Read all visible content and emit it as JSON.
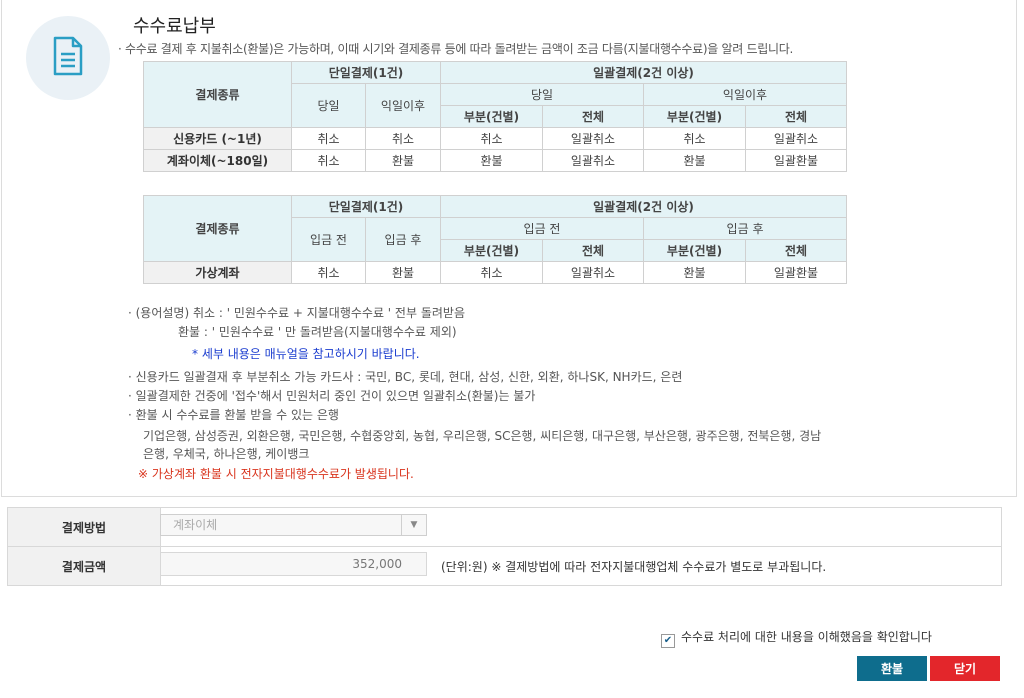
{
  "header": {
    "title": "수수료납부",
    "intro": "· 수수료 결제 후 지불취소(환불)은 가능하며, 이때 시기와 결제종류 등에 따라 돌려받는 금액이 조금 다름(지불대행수수료)을 알려 드립니다."
  },
  "table1": {
    "col_type": "결제종류",
    "single": "단일결제(1건)",
    "bulk": "일괄결제(2건 이상)",
    "sameday": "당일",
    "nextday": "익일이후",
    "partial": "부분(건별)",
    "all": "전체",
    "rows": [
      {
        "label": "신용카드 (~1년)",
        "c1": "취소",
        "c2": "취소",
        "c3": "취소",
        "c4": "일괄취소",
        "c5": "취소",
        "c6": "일괄취소"
      },
      {
        "label": "계좌이체(~180일)",
        "c1": "취소",
        "c2": "환불",
        "c3": "환불",
        "c4": "일괄취소",
        "c5": "환불",
        "c6": "일괄환불"
      }
    ]
  },
  "table2": {
    "col_type": "결제종류",
    "single": "단일결제(1건)",
    "bulk": "일괄결제(2건 이상)",
    "before": "입금 전",
    "after": "입금 후",
    "partial": "부분(건별)",
    "all": "전체",
    "rows": [
      {
        "label": "가상계좌",
        "c1": "취소",
        "c2": "환불",
        "c3": "취소",
        "c4": "일괄취소",
        "c5": "환불",
        "c6": "일괄환불"
      }
    ]
  },
  "notes": {
    "term1": "· (용어설명) 취소 : ' 민원수수료 + 지불대행수수료 ' 전부 돌려받음",
    "term2": "환불 : ' 민원수수료 ' 만 돌려받음(지불대행수수료 제외)",
    "manual": "* 세부 내용은 매뉴얼을 참고하시기 바랍니다.",
    "cards": "· 신용카드 일괄결재 후 부분취소 가능 카드사 : 국민, BC, 롯데, 현대, 삼성, 신한, 외환, 하나SK, NH카드, 은련",
    "bulk": "· 일괄결제한 건중에 '접수'해서 민원처리 중인 건이 있으면 일괄취소(환불)는 불가",
    "banks_title": "· 환불 시 수수료를 환불 받을 수 있는 은행",
    "banks1": "기업은행, 삼성증권, 외환은행, 국민은행, 수협중앙회, 농협, 우리은행, SC은행, 씨티은행, 대구은행, 부산은행, 광주은행, 전북은행, 경남",
    "banks2": "은행, 우체국, 하나은행, 케이뱅크",
    "warning": "※ 가상계좌 환불 시 전자지불대행수수료가 발생됩니다."
  },
  "form": {
    "method_label": "결제방법",
    "method_value": "계좌이체",
    "amount_label": "결제금액",
    "amount_value": "352,000",
    "unit_note": "(단위:원) ※ 결제방법에 따라 전자지불대행업체 수수료가 별도로 부과됩니다."
  },
  "footer": {
    "agree_text": "수수료 처리에 대한 내용을 이해했음을 확인합니다",
    "agree_checked": true,
    "refund_button": "환불",
    "close_button": "닫기"
  },
  "colors": {
    "accent": "#0e6d8d",
    "danger": "#e3262b",
    "header_bg": "#e4f3f6",
    "link": "#1a3ccf"
  }
}
